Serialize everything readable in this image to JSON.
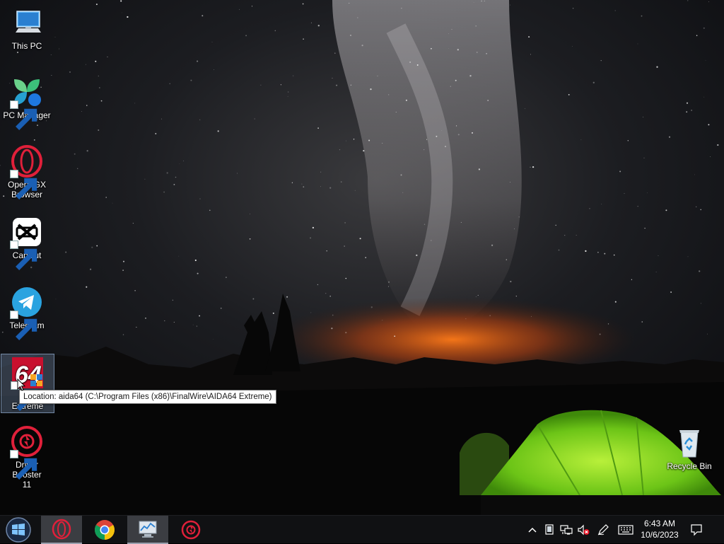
{
  "desktop": {
    "icons": [
      {
        "label": "This PC",
        "icon": "this-pc-icon"
      },
      {
        "label": "PC Manager",
        "icon": "pc-manager-icon"
      },
      {
        "label": "Opera GX\nBrowser",
        "icon": "opera-gx-icon"
      },
      {
        "label": "CapCut",
        "icon": "capcut-icon"
      },
      {
        "label": "Telegram",
        "icon": "telegram-icon"
      },
      {
        "label": "A\nExtreme",
        "icon": "aida64-icon"
      },
      {
        "label": "Driver Booster\n11",
        "icon": "driver-booster-icon"
      },
      {
        "label": "Recycle Bin",
        "icon": "recycle-bin-icon"
      }
    ],
    "tooltip": "Location: aida64 (C:\\Program Files (x86)\\FinalWire\\AIDA64 Extreme)"
  },
  "taskbar": {
    "items": [
      "start-icon",
      "opera-gx-icon",
      "chrome-icon",
      "resource-monitor-icon",
      "driver-booster-icon"
    ],
    "tray": [
      "chevron-up-icon",
      "tablet-icon",
      "network-icon",
      "volume-muted-icon",
      "pen-icon",
      "keyboard-icon"
    ],
    "clock": {
      "time": "6:43 AM",
      "date": "10/6/2023"
    },
    "notification_icon": "action-center-icon"
  },
  "colors": {
    "taskbar_bg": "#101113",
    "opera_red": "#e0203a",
    "tent_green": "#7ed321",
    "telegram_blue": "#2aa3e0"
  }
}
